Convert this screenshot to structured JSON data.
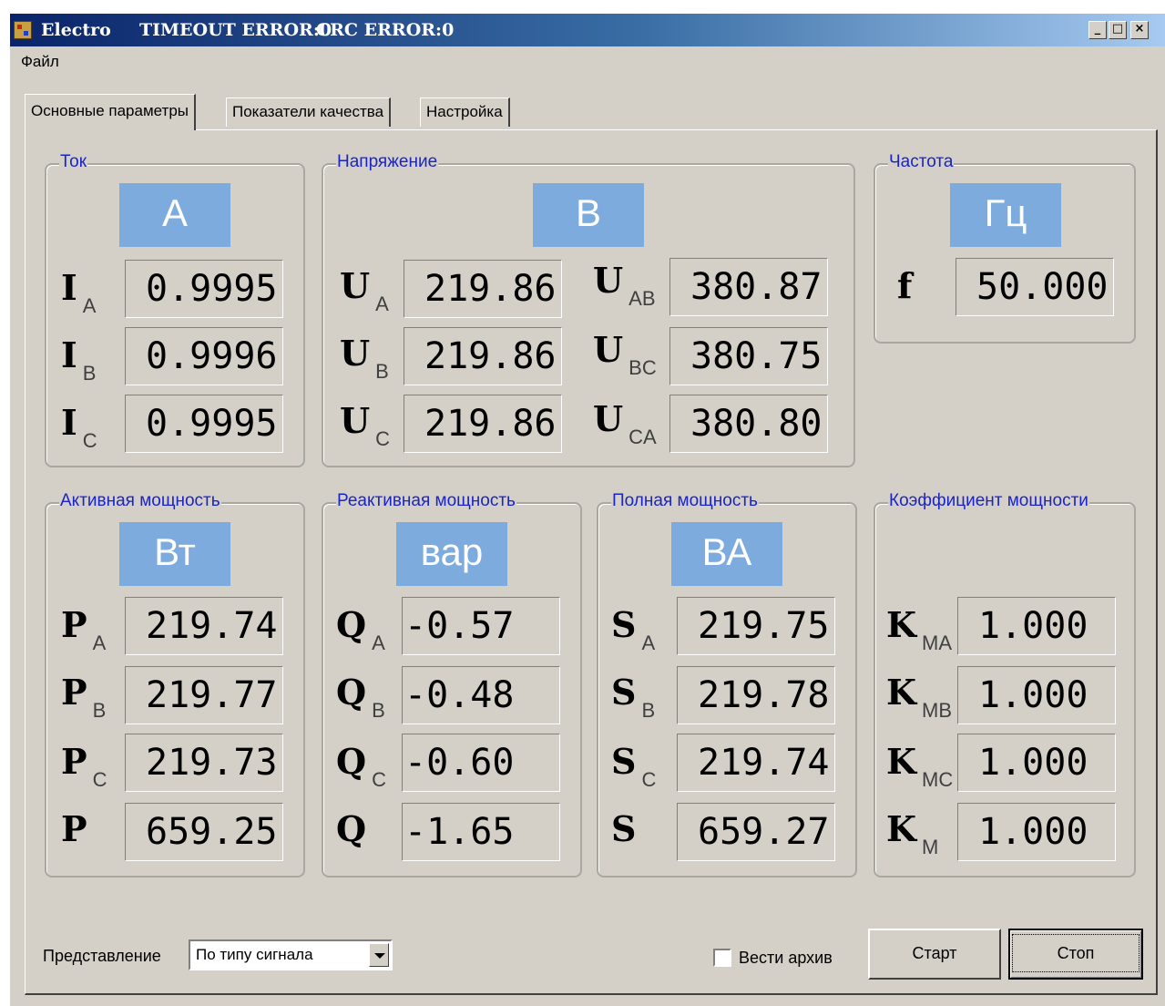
{
  "window": {
    "app_name": "Electro",
    "timeout_error": "TIMEOUT ERROR:0",
    "crc_error": "CRC ERROR:0",
    "controls": {
      "minimize": "_",
      "maximize": "□",
      "close": "×"
    }
  },
  "menu": {
    "file": "Файл"
  },
  "tabs": [
    {
      "label": "Основные параметры",
      "active": true
    },
    {
      "label": "Показатели качества",
      "active": false
    },
    {
      "label": "Настройка",
      "active": false
    }
  ],
  "groups": {
    "current": {
      "title": "Ток",
      "unit": "А",
      "rows": [
        {
          "sym": "I",
          "sub": "A",
          "value": "0.9995"
        },
        {
          "sym": "I",
          "sub": "B",
          "value": "0.9996"
        },
        {
          "sym": "I",
          "sub": "C",
          "value": "0.9995"
        }
      ]
    },
    "voltage": {
      "title": "Напряжение",
      "unit": "В",
      "phase_rows": [
        {
          "sym": "U",
          "sub": "A",
          "value": "219.86"
        },
        {
          "sym": "U",
          "sub": "B",
          "value": "219.86"
        },
        {
          "sym": "U",
          "sub": "C",
          "value": "219.86"
        }
      ],
      "line_rows": [
        {
          "sym": "U",
          "sub": "AB",
          "value": "380.87"
        },
        {
          "sym": "U",
          "sub": "BC",
          "value": "380.75"
        },
        {
          "sym": "U",
          "sub": "CA",
          "value": "380.80"
        }
      ]
    },
    "frequency": {
      "title": "Частота",
      "unit": "Гц",
      "rows": [
        {
          "sym": "f",
          "sub": "",
          "value": "50.000"
        }
      ]
    },
    "active_power": {
      "title": "Активная мощность",
      "unit": "Вт",
      "rows": [
        {
          "sym": "P",
          "sub": "A",
          "value": "219.74"
        },
        {
          "sym": "P",
          "sub": "B",
          "value": "219.77"
        },
        {
          "sym": "P",
          "sub": "C",
          "value": "219.73"
        },
        {
          "sym": "P",
          "sub": "",
          "value": "659.25"
        }
      ]
    },
    "reactive_power": {
      "title": "Реактивная мощность",
      "unit": "вар",
      "rows": [
        {
          "sym": "Q",
          "sub": "A",
          "value": "-0.57"
        },
        {
          "sym": "Q",
          "sub": "B",
          "value": "-0.48"
        },
        {
          "sym": "Q",
          "sub": "C",
          "value": "-0.60"
        },
        {
          "sym": "Q",
          "sub": "",
          "value": "-1.65"
        }
      ]
    },
    "apparent_power": {
      "title": "Полная мощность",
      "unit": "ВА",
      "rows": [
        {
          "sym": "S",
          "sub": "A",
          "value": "219.75"
        },
        {
          "sym": "S",
          "sub": "B",
          "value": "219.78"
        },
        {
          "sym": "S",
          "sub": "C",
          "value": "219.74"
        },
        {
          "sym": "S",
          "sub": "",
          "value": "659.27"
        }
      ]
    },
    "power_factor": {
      "title": "Коэффициент мощности",
      "rows": [
        {
          "sym": "K",
          "sub": "MA",
          "value": "1.000"
        },
        {
          "sym": "K",
          "sub": "MB",
          "value": "1.000"
        },
        {
          "sym": "K",
          "sub": "MC",
          "value": "1.000"
        },
        {
          "sym": "K",
          "sub": "M",
          "value": "1.000"
        }
      ]
    }
  },
  "bottom": {
    "view_label": "Представление",
    "view_selected": "По типу сигнала",
    "archive_label": "Вести архив",
    "archive_checked": false,
    "start_button": "Старт",
    "stop_button": "Стоп"
  }
}
